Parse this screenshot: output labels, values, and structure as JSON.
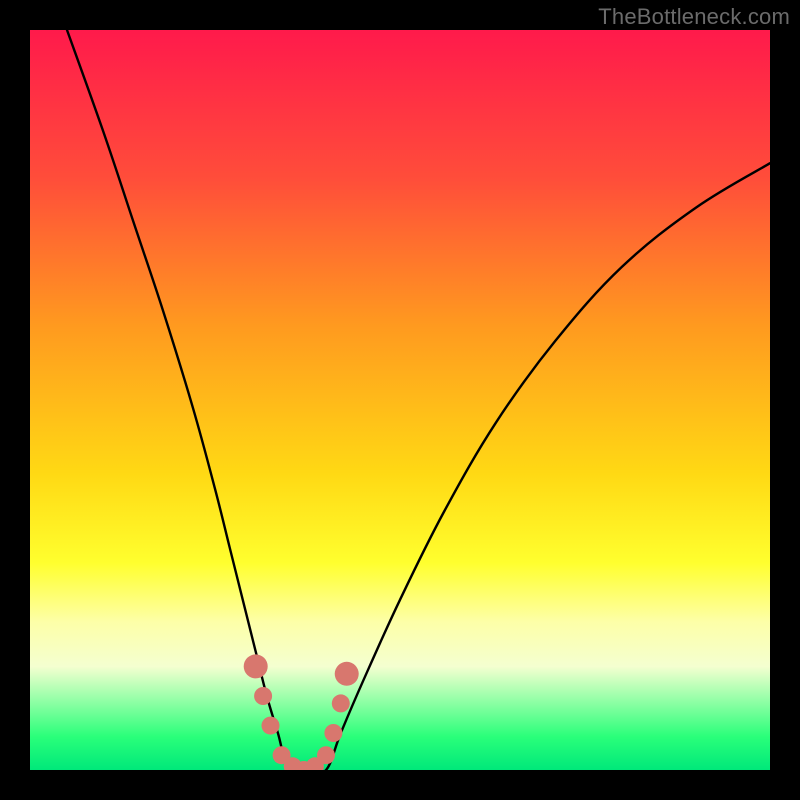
{
  "watermark": "TheBottleneck.com",
  "chart_data": {
    "type": "line",
    "title": "",
    "xlabel": "",
    "ylabel": "",
    "xlim": [
      0,
      100
    ],
    "ylim": [
      0,
      100
    ],
    "gradient_stops": [
      {
        "offset": 0.0,
        "color": "#ff1a4b"
      },
      {
        "offset": 0.2,
        "color": "#ff4d3a"
      },
      {
        "offset": 0.4,
        "color": "#ff9a1f"
      },
      {
        "offset": 0.6,
        "color": "#ffd914"
      },
      {
        "offset": 0.72,
        "color": "#ffff2e"
      },
      {
        "offset": 0.8,
        "color": "#fdffa8"
      },
      {
        "offset": 0.86,
        "color": "#f4ffd0"
      },
      {
        "offset": 0.955,
        "color": "#2aff7a"
      },
      {
        "offset": 1.0,
        "color": "#00e87a"
      }
    ],
    "series": [
      {
        "name": "bottleneck-curve-left",
        "x": [
          5,
          10,
          14,
          18,
          22,
          25,
          27,
          29,
          30.5,
          32,
          33.5,
          35
        ],
        "y": [
          100,
          86,
          74,
          62,
          49,
          38,
          30,
          22,
          16,
          10,
          5,
          0
        ]
      },
      {
        "name": "bottleneck-curve-right",
        "x": [
          40,
          42,
          45,
          50,
          56,
          63,
          71,
          80,
          90,
          100
        ],
        "y": [
          0,
          5,
          12,
          23,
          35,
          47,
          58,
          68,
          76,
          82
        ]
      }
    ],
    "curve_trough": {
      "x_range": [
        35,
        40
      ],
      "y": 0
    },
    "markers": {
      "name": "highlight-dots",
      "color": "#d8776e",
      "radius_large": 12,
      "radius_small": 9,
      "points": [
        {
          "x": 30.5,
          "y": 14
        },
        {
          "x": 31.5,
          "y": 10
        },
        {
          "x": 32.5,
          "y": 6
        },
        {
          "x": 34.0,
          "y": 2
        },
        {
          "x": 35.5,
          "y": 0.5
        },
        {
          "x": 37.0,
          "y": 0
        },
        {
          "x": 38.5,
          "y": 0.5
        },
        {
          "x": 40.0,
          "y": 2
        },
        {
          "x": 41.0,
          "y": 5
        },
        {
          "x": 42.0,
          "y": 9
        },
        {
          "x": 42.8,
          "y": 13
        }
      ]
    }
  }
}
